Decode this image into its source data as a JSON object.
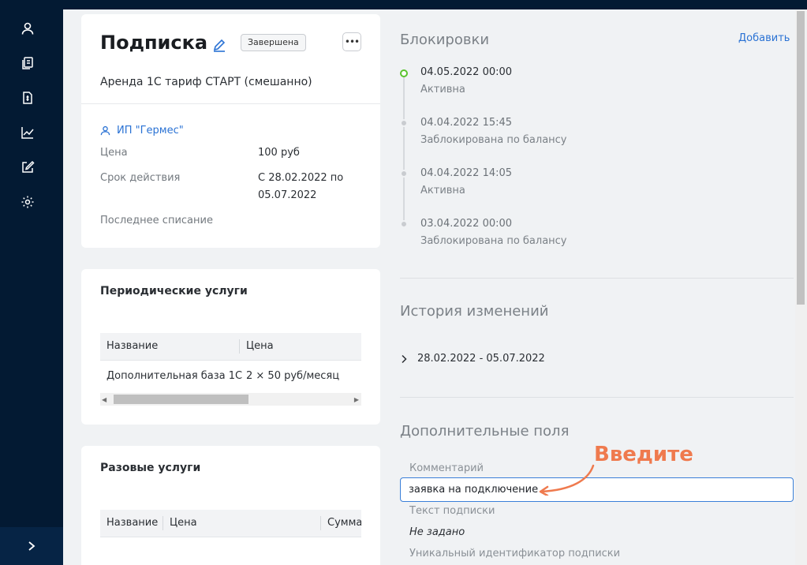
{
  "sidebar": {
    "icons": [
      "user-icon",
      "documents-icon",
      "invoice-icon",
      "chart-icon",
      "edit-icon",
      "gear-icon"
    ],
    "expand_icon": "chevron-right-icon"
  },
  "subscription": {
    "title": "Подписка",
    "status_badge": "Завершена",
    "tariff": "Аренда 1С тариф СТАРТ (смешанно)",
    "client": "ИП \"Гермес\"",
    "price_label": "Цена",
    "price_value": "100 руб",
    "period_label": "Срок действия",
    "period_value_line1": "С 28.02.2022 по",
    "period_value_line2": "05.07.2022",
    "last_charge_label": "Последнее списание"
  },
  "periodic_services": {
    "title": "Периодические услуги",
    "columns": [
      "Название",
      "Цена"
    ],
    "rows": [
      {
        "name": "Дополнительная база 1С",
        "price": "2 × 50 руб/месяц"
      }
    ]
  },
  "one_time_services": {
    "title": "Разовые услуги",
    "columns": [
      "Название",
      "Цена",
      "Сумма"
    ]
  },
  "blocks": {
    "title": "Блокировки",
    "add_label": "Добавить",
    "items": [
      {
        "date": "04.05.2022 00:00",
        "status": "Активна",
        "active": true
      },
      {
        "date": "04.04.2022 15:45",
        "status": "Заблокирована по балансу",
        "active": false
      },
      {
        "date": "04.04.2022 14:05",
        "status": "Активна",
        "active": false
      },
      {
        "date": "03.04.2022 00:00",
        "status": "Заблокирована по балансу",
        "active": false
      }
    ]
  },
  "history": {
    "title": "История изменений",
    "period": "28.02.2022 - 05.07.2022"
  },
  "extra_fields": {
    "title": "Дополнительные поля",
    "comment_label": "Комментарий",
    "comment_value": "заявка на подключение",
    "text_label": "Текст подписки",
    "text_value": "Не задано",
    "uid_label": "Уникальный идентификатор подписки"
  },
  "annotation": {
    "hint": "Введите",
    "color": "#ef7a4e"
  },
  "colors": {
    "sidebar": "#031a33",
    "accent": "#2a72d4",
    "active_dot": "#5ac32f"
  }
}
